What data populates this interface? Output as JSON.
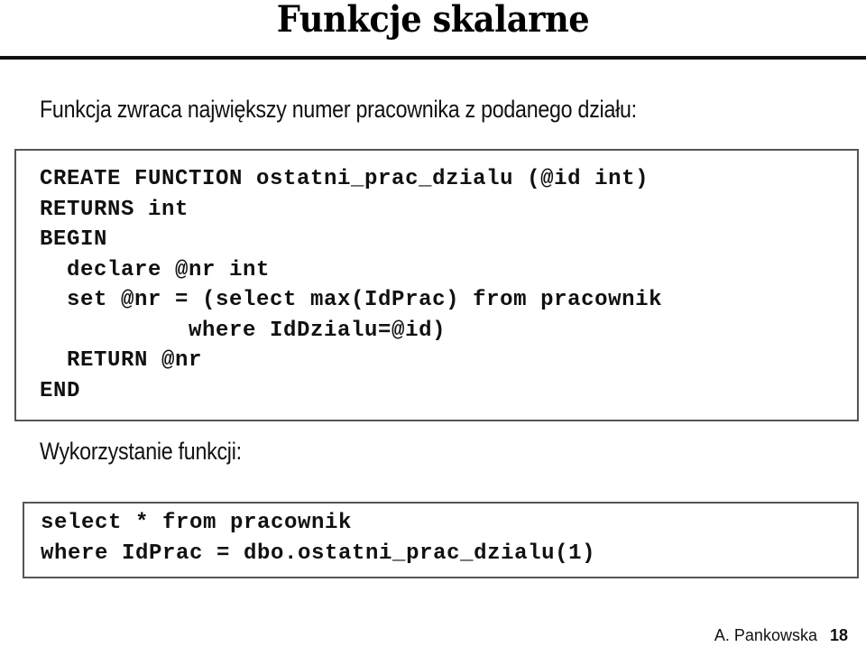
{
  "slide": {
    "title": "Funkcje skalarne",
    "caption_definition": "Funkcja zwraca największy numer pracownika z podanego działu:",
    "code_definition": [
      "CREATE FUNCTION ostatni_prac_dzialu (@id int)",
      "RETURNS int",
      "BEGIN",
      "  declare @nr int",
      "  set @nr = (select max(IdPrac) from pracownik",
      "           where IdDzialu=@id)",
      "  RETURN @nr",
      "END"
    ],
    "caption_usage": "Wykorzystanie funkcji:",
    "code_usage": [
      "select * from pracownik",
      "where IdPrac = dbo.ostatni_prac_dzialu(1)"
    ]
  },
  "footer": {
    "author": "A. Pankowska",
    "page_number": "18"
  }
}
